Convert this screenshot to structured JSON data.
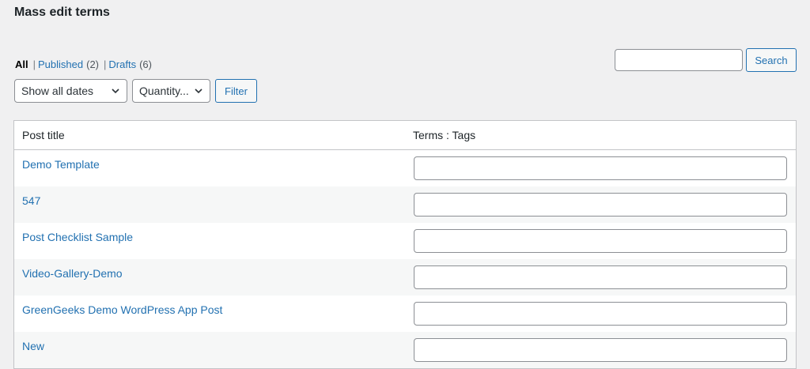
{
  "page": {
    "title": "Mass edit terms"
  },
  "views": {
    "all_label": "All",
    "published_label": "Published",
    "published_count": "(2)",
    "drafts_label": "Drafts",
    "drafts_count": "(6)",
    "separator": "|"
  },
  "search": {
    "value": "",
    "placeholder": "",
    "button_label": "Search"
  },
  "filters": {
    "dates_selected": "Show all dates",
    "quantity_selected": "Quantity...",
    "filter_button_label": "Filter"
  },
  "table": {
    "columns": [
      "Post title",
      "Terms : Tags"
    ],
    "rows": [
      {
        "title": "Demo Template",
        "terms_value": ""
      },
      {
        "title": "547",
        "terms_value": ""
      },
      {
        "title": "Post Checklist Sample",
        "terms_value": ""
      },
      {
        "title": "Video-Gallery-Demo",
        "terms_value": ""
      },
      {
        "title": "GreenGeeks Demo WordPress App Post",
        "terms_value": ""
      },
      {
        "title": "New",
        "terms_value": ""
      }
    ]
  },
  "colors": {
    "link": "#2271b1",
    "background": "#f0f0f1",
    "border": "#c3c4c7"
  }
}
